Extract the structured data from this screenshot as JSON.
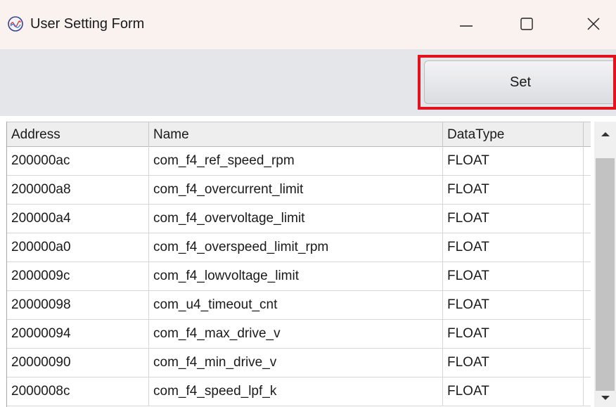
{
  "window": {
    "title": "User Setting Form",
    "icon": "app-gauge-icon"
  },
  "toolbar": {
    "set_label": "Set",
    "highlight_color": "#e3121f"
  },
  "table": {
    "columns": [
      "Address",
      "Name",
      "DataType"
    ],
    "rows": [
      {
        "address": "200000ac",
        "name": "com_f4_ref_speed_rpm",
        "datatype": "FLOAT"
      },
      {
        "address": "200000a8",
        "name": "com_f4_overcurrent_limit",
        "datatype": "FLOAT"
      },
      {
        "address": "200000a4",
        "name": "com_f4_overvoltage_limit",
        "datatype": "FLOAT"
      },
      {
        "address": "200000a0",
        "name": "com_f4_overspeed_limit_rpm",
        "datatype": "FLOAT"
      },
      {
        "address": "2000009c",
        "name": "com_f4_lowvoltage_limit",
        "datatype": "FLOAT"
      },
      {
        "address": "20000098",
        "name": "com_u4_timeout_cnt",
        "datatype": "FLOAT"
      },
      {
        "address": "20000094",
        "name": "com_f4_max_drive_v",
        "datatype": "FLOAT"
      },
      {
        "address": "20000090",
        "name": "com_f4_min_drive_v",
        "datatype": "FLOAT"
      },
      {
        "address": "2000008c",
        "name": "com_f4_speed_lpf_k",
        "datatype": "FLOAT"
      }
    ]
  }
}
